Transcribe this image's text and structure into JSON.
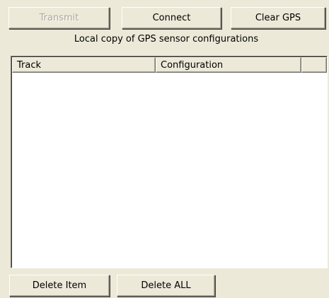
{
  "toolbar": {
    "transmit_label": "Transmit",
    "connect_label": "Connect",
    "clear_gps_label": "Clear GPS"
  },
  "caption": "Local copy of GPS sensor configurations",
  "table": {
    "columns": [
      "Track",
      "Configuration",
      ""
    ],
    "rows": []
  },
  "footer": {
    "delete_item_label": "Delete Item",
    "delete_all_label": "Delete ALL"
  }
}
